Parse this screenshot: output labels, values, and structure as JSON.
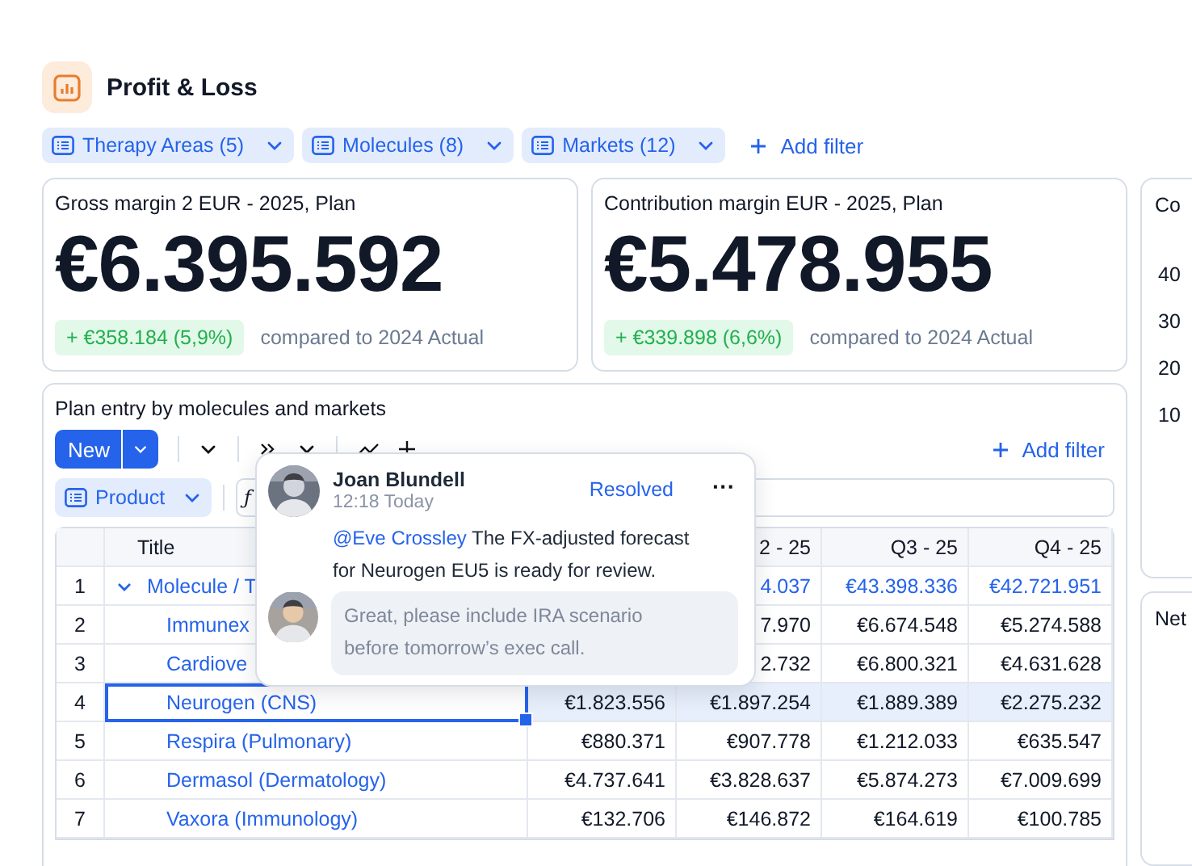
{
  "header": {
    "title": "Profit & Loss"
  },
  "filters": [
    {
      "label": "Therapy Areas (5)"
    },
    {
      "label": "Molecules (8)"
    },
    {
      "label": "Markets (12)"
    }
  ],
  "add_filter": "Add filter",
  "kpis": [
    {
      "title": "Gross margin 2 EUR - 2025, Plan",
      "value": "€6.395.592",
      "delta": "+ €358.184 (5,9%)",
      "comparison": "compared to 2024 Actual"
    },
    {
      "title": "Contribution margin EUR - 2025, Plan",
      "value": "€5.478.955",
      "delta": "+ €339.898 (6,6%)",
      "comparison": "compared to 2024 Actual"
    }
  ],
  "side_cards": [
    {
      "title": "Co",
      "axis_ticks": [
        "40",
        "30",
        "20",
        "10"
      ]
    },
    {
      "title": "Net"
    }
  ],
  "plan": {
    "title": "Plan entry by molecules and markets",
    "new_button": "New",
    "add_filter": "Add filter",
    "group_chip": "Product",
    "formula_icon": "ƒ",
    "columns": [
      "Title",
      "2 - 25",
      "Q3 - 25",
      "Q4 - 25"
    ],
    "rows": [
      {
        "num": "1",
        "title": "Molecule / T",
        "kind": "group",
        "expanded": true,
        "selected": false,
        "values": [
          "4.037",
          "€43.398.336",
          "€42.721.951"
        ]
      },
      {
        "num": "2",
        "title": "Immunex",
        "kind": "item",
        "selected": false,
        "values": [
          "7.970",
          "€6.674.548",
          "€5.274.588"
        ]
      },
      {
        "num": "3",
        "title": "Cardiove",
        "kind": "item",
        "selected": false,
        "values": [
          "2.732",
          "€6.800.321",
          "€4.631.628"
        ]
      },
      {
        "num": "4",
        "title": "Neurogen (CNS)",
        "kind": "item",
        "selected": true,
        "values": [
          "€1.823.556",
          "€1.897.254",
          "€1.889.389",
          "€2.275.232"
        ]
      },
      {
        "num": "5",
        "title": "Respira (Pulmonary)",
        "kind": "item",
        "selected": false,
        "values": [
          "€880.371",
          "€907.778",
          "€1.212.033",
          "€635.547"
        ]
      },
      {
        "num": "6",
        "title": "Dermasol (Dermatology)",
        "kind": "item",
        "selected": false,
        "values": [
          "€4.737.641",
          "€3.828.637",
          "€5.874.273",
          "€7.009.699"
        ]
      },
      {
        "num": "7",
        "title": "Vaxora (Immunology)",
        "kind": "item",
        "selected": false,
        "values": [
          "€132.706",
          "€146.872",
          "€164.619",
          "€100.785"
        ]
      }
    ]
  },
  "comment": {
    "author": "Joan Blundell",
    "time": "12:18 Today",
    "status": "Resolved",
    "menu": "···",
    "mention": "@Eve Crossley",
    "text": "The FX-adjusted forecast for Neurogen EU5 is ready for review.",
    "reply": {
      "placeholder": "Great, please include IRA scenario before tomorrow’s exec call."
    }
  }
}
